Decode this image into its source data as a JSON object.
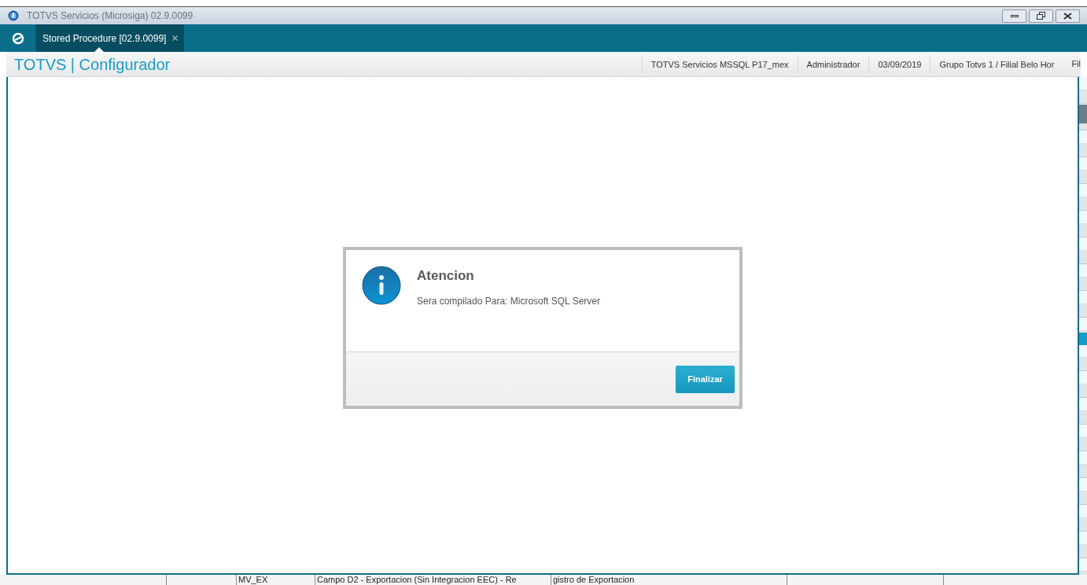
{
  "window": {
    "title": "TOTVS Servicios (Microsiga) 02.9.0099"
  },
  "tabs": [
    {
      "label": "Stored Procedure [02.9.0099]",
      "selected": true,
      "closable": true
    }
  ],
  "header": {
    "app_title": "TOTVS | Configurador",
    "info": [
      "TOTVS Servicios MSSQL P17_mex",
      "Administrador",
      "03/09/2019",
      "Grupo Totvs 1 / Filial Belo Hor",
      "Fil"
    ]
  },
  "dialog": {
    "title": "Atencion",
    "message": "Sera compilado Para: Microsoft SQL Server",
    "button": "Finalizar"
  },
  "background_table": {
    "row": [
      "MV_EX",
      "Campo D2 - Exportacion (Sin Integracion EEC) - Re",
      "gistro de Exportacion"
    ]
  }
}
